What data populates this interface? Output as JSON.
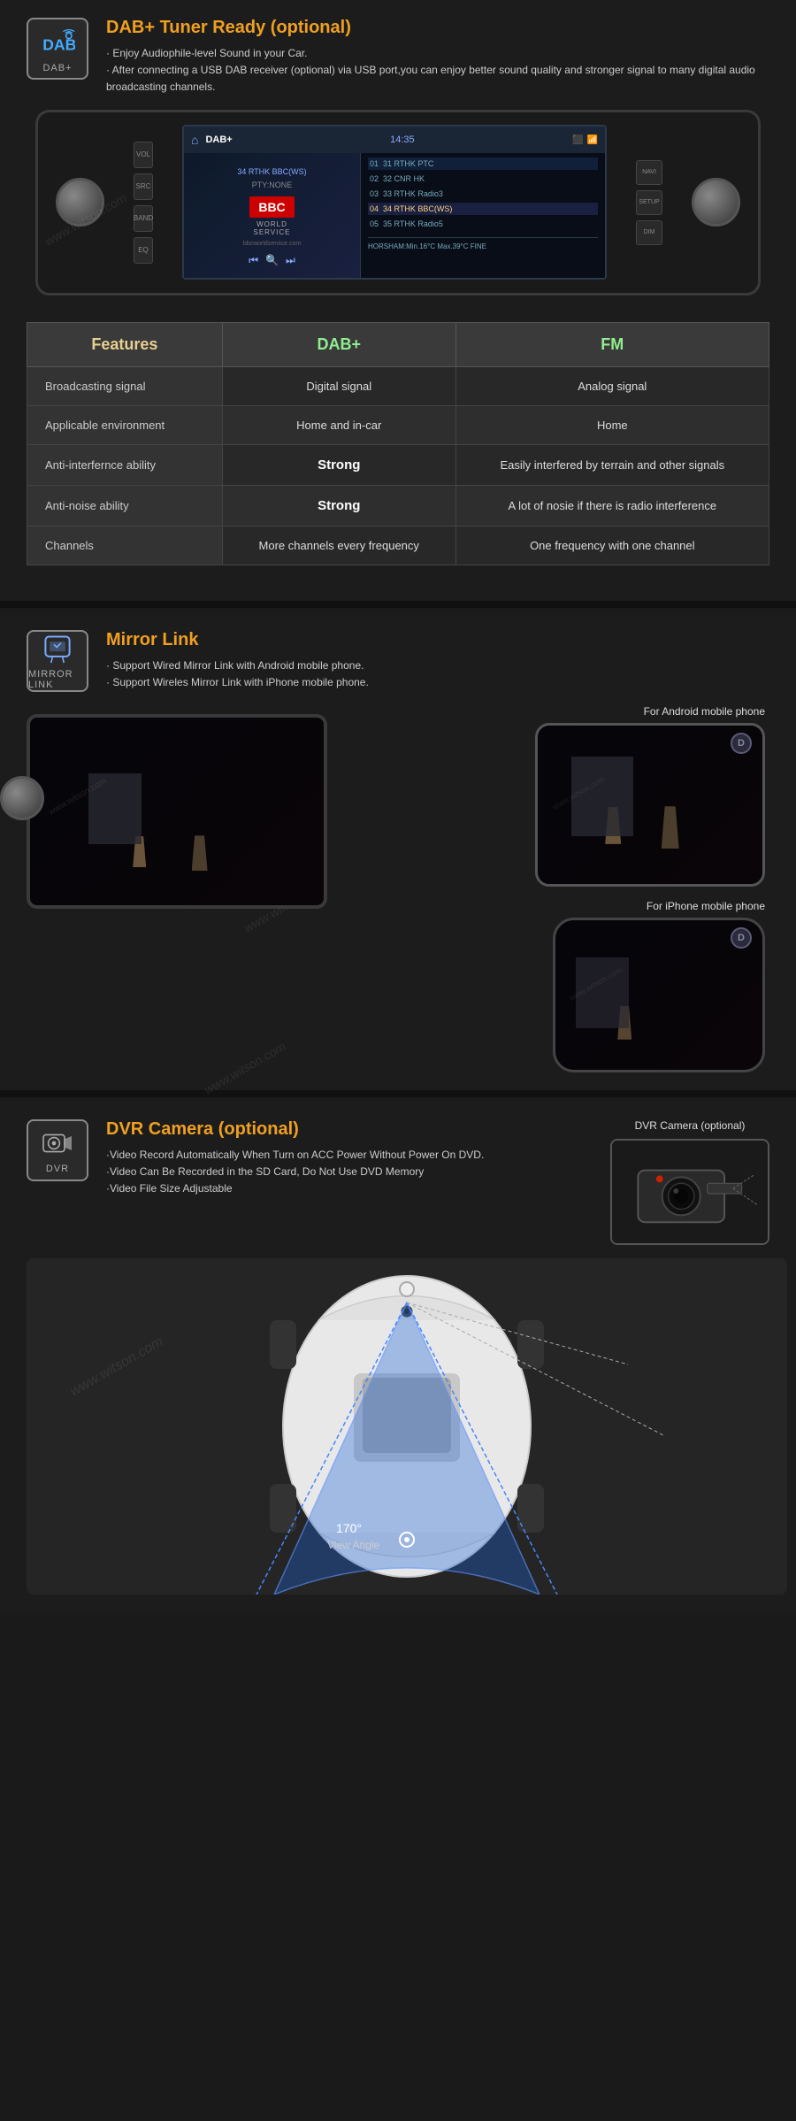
{
  "dab": {
    "icon_label": "DAB+",
    "title": "DAB+ Tuner Ready (optional)",
    "desc1": "· Enjoy Audiophile-level Sound in your Car.",
    "desc2": "· After connecting a USB DAB receiver (optional) via USB port,you can enjoy better sound quality and stronger signal to many digital audio broadcasting channels.",
    "screen": {
      "title": "DAB+",
      "time": "14:35",
      "station": "34 RTHK BBC(WS)",
      "pty": "PTY:NONE",
      "channels": [
        {
          "num": "01",
          "name": "31 RTHK PTC"
        },
        {
          "num": "02",
          "name": "32 CNR HK"
        },
        {
          "num": "03",
          "name": "33 RTHK Radio3"
        },
        {
          "num": "04",
          "name": "34 RTHK BBC(WS)"
        },
        {
          "num": "05",
          "name": "35 RTHK Radio5"
        }
      ],
      "weather": "HORSHAM:Min.16°C Max.39°C FINE"
    }
  },
  "comparison": {
    "headers": [
      "Features",
      "DAB+",
      "FM"
    ],
    "rows": [
      {
        "feature": "Broadcasting signal",
        "dab": "Digital signal",
        "fm": "Analog signal"
      },
      {
        "feature": "Applicable environment",
        "dab": "Home and in-car",
        "fm": "Home"
      },
      {
        "feature": "Anti-interfernce ability",
        "dab": "Strong",
        "fm": "Easily interfered by terrain and other signals"
      },
      {
        "feature": "Anti-noise ability",
        "dab": "Strong",
        "fm": "A lot of nosie if there is radio interference"
      },
      {
        "feature": "Channels",
        "dab": "More channels every frequency",
        "fm": "One frequency with one channel"
      }
    ]
  },
  "mirror": {
    "icon_label": "MIRROR LINK",
    "title": "Mirror Link",
    "desc1": "· Support Wired Mirror Link with Android mobile phone.",
    "desc2": "· Support Wireles Mirror Link with iPhone mobile phone.",
    "android_label": "For Android mobile phone",
    "iphone_label": "For iPhone mobile phone"
  },
  "dvr": {
    "icon_label": "DVR",
    "title": "DVR Camera (optional)",
    "camera_label": "DVR Camera (optional)",
    "desc1": "·Video Record Automatically When Turn on ACC Power Without Power On DVD.",
    "desc2": "·Video Can Be Recorded in the SD Card, Do Not Use DVD Memory",
    "desc3": "·Video File Size Adjustable",
    "view_angle": "170°",
    "view_angle_label": "View Angle"
  },
  "watermark": "www.witson.com"
}
